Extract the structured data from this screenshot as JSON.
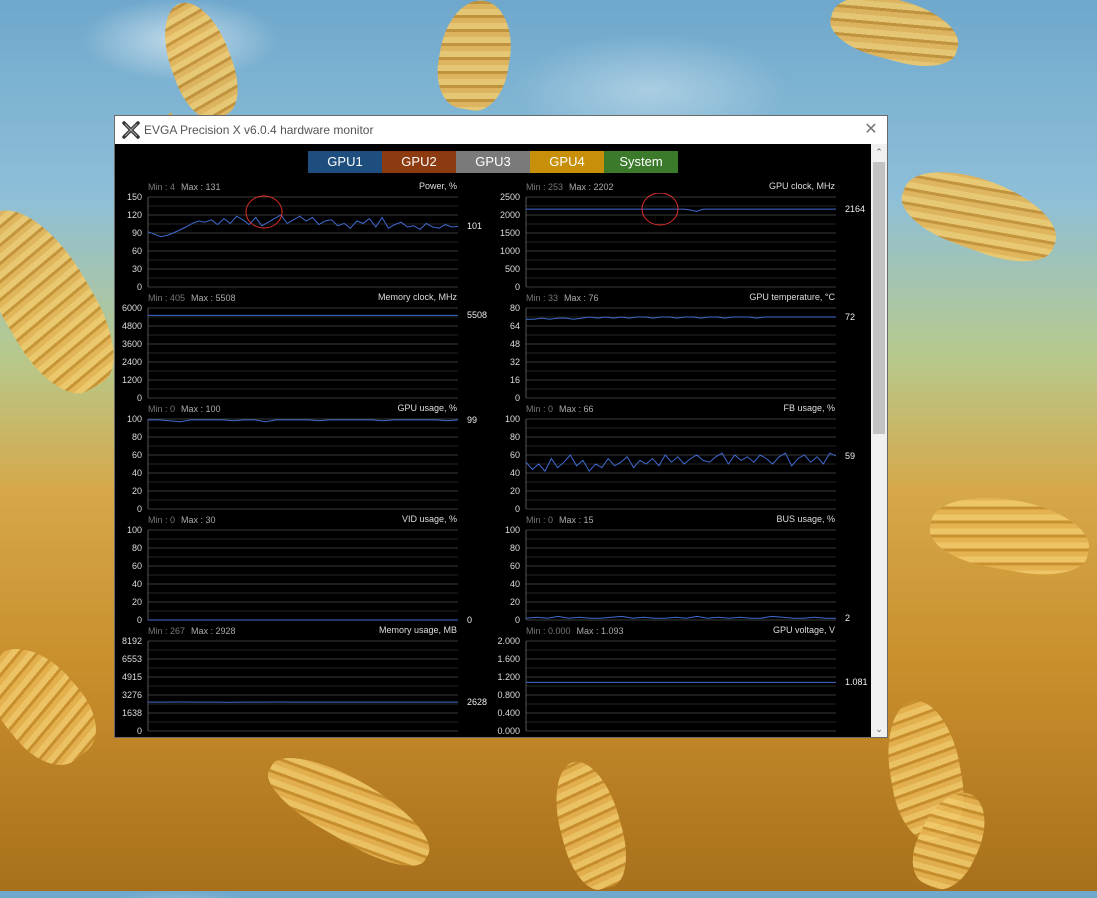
{
  "window": {
    "title": "EVGA Precision X v6.0.4 hardware monitor",
    "close_glyph": "✕"
  },
  "tabs": [
    {
      "label": "GPU1",
      "color": "#1e4e7e"
    },
    {
      "label": "GPU2",
      "color": "#8c3a10"
    },
    {
      "label": "GPU3",
      "color": "#7a7a7a"
    },
    {
      "label": "GPU4",
      "color": "#c8900a"
    },
    {
      "label": "System",
      "color": "#3a7a2a"
    }
  ],
  "scrollbar": {
    "up_glyph": "⌃",
    "down_glyph": "⌄"
  },
  "chart_data": [
    {
      "type": "line",
      "title": "Power, %",
      "min_text": "Min : 4",
      "max_text": "Max : 131",
      "ylabels": [
        "150",
        "120",
        "90",
        "60",
        "30",
        "0"
      ],
      "ylim": [
        0,
        150
      ],
      "current": "101",
      "series": [
        {
          "values": [
            92,
            88,
            84,
            86,
            90,
            95,
            100,
            106,
            110,
            108,
            112,
            104,
            114,
            106,
            118,
            112,
            104,
            116,
            102,
            108,
            114,
            120,
            106,
            112,
            118,
            110,
            116,
            104,
            110,
            112,
            102,
            106,
            98,
            110,
            106,
            114,
            100,
            116,
            98,
            104,
            108,
            100,
            102,
            96,
            106,
            100,
            98,
            104,
            100,
            101
          ]
        }
      ],
      "highlight_circle": true
    },
    {
      "type": "line",
      "title": "GPU clock, MHz",
      "min_text": "Min : 253",
      "max_text": "Max : 2202",
      "ylabels": [
        "2500",
        "2000",
        "1500",
        "1000",
        "500",
        "0"
      ],
      "ylim": [
        0,
        2500
      ],
      "current": "2164",
      "series": [
        {
          "values": [
            2164,
            2164,
            2164,
            2164,
            2164,
            2164,
            2164,
            2164,
            2164,
            2164,
            2164,
            2164,
            2164,
            2164,
            2164,
            2164,
            2164,
            2164,
            2164,
            2164,
            2164,
            2164,
            2164,
            2164,
            2164,
            2164,
            2140,
            2100,
            2164,
            2164,
            2164,
            2164,
            2164,
            2164,
            2164,
            2164,
            2164,
            2164,
            2164,
            2164,
            2164,
            2164,
            2164,
            2164,
            2164,
            2164,
            2164,
            2164,
            2164,
            2164
          ]
        }
      ],
      "highlight_circle": true
    },
    {
      "type": "line",
      "title": "Memory clock, MHz",
      "min_text": "Min : 405",
      "max_text": "Max : 5508",
      "ylabels": [
        "6000",
        "4800",
        "3600",
        "2400",
        "1200",
        "0"
      ],
      "ylim": [
        0,
        6000
      ],
      "current": "5508",
      "series": [
        {
          "values": [
            5508,
            5508,
            5508,
            5508,
            5508,
            5508,
            5508,
            5508,
            5508,
            5508,
            5508,
            5508,
            5508,
            5508,
            5508,
            5508,
            5508,
            5508,
            5508,
            5508
          ]
        }
      ]
    },
    {
      "type": "line",
      "title": "GPU temperature, °C",
      "min_text": "Min : 33",
      "max_text": "Max : 76",
      "ylabels": [
        "80",
        "64",
        "48",
        "32",
        "16",
        "0"
      ],
      "ylim": [
        0,
        80
      ],
      "current": "72",
      "series": [
        {
          "values": [
            70,
            70,
            71,
            70,
            71,
            71,
            70,
            71,
            72,
            71,
            72,
            71,
            72,
            71,
            72,
            72,
            71,
            72,
            72,
            71,
            72,
            72,
            71,
            72,
            72,
            71,
            72,
            72,
            72,
            71,
            72,
            72,
            72,
            72,
            72,
            72,
            72,
            72,
            72,
            72
          ]
        }
      ]
    },
    {
      "type": "line",
      "title": "GPU usage, %",
      "min_text": "Min : 0",
      "max_text": "Max : 100",
      "ylabels": [
        "100",
        "80",
        "60",
        "40",
        "20",
        "0"
      ],
      "ylim": [
        0,
        100
      ],
      "current": "99",
      "series": [
        {
          "values": [
            99,
            99,
            98,
            97,
            99,
            99,
            99,
            99,
            98,
            99,
            99,
            97,
            99,
            99,
            99,
            99,
            98,
            99,
            99,
            99,
            99,
            99,
            98,
            99,
            99,
            99,
            99,
            99,
            98,
            99
          ]
        }
      ]
    },
    {
      "type": "line",
      "title": "FB usage, %",
      "min_text": "Min : 0",
      "max_text": "Max : 66",
      "ylabels": [
        "100",
        "80",
        "60",
        "40",
        "20",
        "0"
      ],
      "ylim": [
        0,
        100
      ],
      "current": "59",
      "series": [
        {
          "values": [
            52,
            44,
            50,
            42,
            56,
            46,
            52,
            60,
            48,
            54,
            42,
            50,
            46,
            56,
            48,
            52,
            58,
            46,
            54,
            50,
            56,
            48,
            60,
            52,
            58,
            50,
            56,
            60,
            54,
            52,
            58,
            62,
            50,
            60,
            54,
            58,
            52,
            60,
            56,
            50,
            58,
            62,
            48,
            56,
            60,
            52,
            58,
            50,
            62,
            59
          ]
        }
      ]
    },
    {
      "type": "line",
      "title": "VID usage, %",
      "min_text": "Min : 0",
      "max_text": "Max : 30",
      "ylabels": [
        "100",
        "80",
        "60",
        "40",
        "20",
        "0"
      ],
      "ylim": [
        0,
        100
      ],
      "current": "0",
      "series": [
        {
          "values": [
            0,
            0,
            0,
            0,
            0,
            0,
            0,
            0,
            0,
            0
          ]
        }
      ]
    },
    {
      "type": "line",
      "title": "BUS usage, %",
      "min_text": "Min : 0",
      "max_text": "Max : 15",
      "ylabels": [
        "100",
        "80",
        "60",
        "40",
        "20",
        "0"
      ],
      "ylim": [
        0,
        100
      ],
      "current": "2",
      "series": [
        {
          "values": [
            2,
            3,
            2,
            4,
            2,
            3,
            2,
            2,
            3,
            4,
            2,
            3,
            2,
            2,
            3,
            2,
            4,
            2,
            3,
            2,
            3,
            2,
            2,
            4,
            3,
            2,
            2,
            3,
            2,
            2
          ]
        }
      ]
    },
    {
      "type": "line",
      "title": "Memory usage, MB",
      "min_text": "Min : 267",
      "max_text": "Max : 2928",
      "ylabels": [
        "8192",
        "6553",
        "4915",
        "3276",
        "1638",
        "0"
      ],
      "ylim": [
        0,
        8192
      ],
      "current": "2628",
      "series": [
        {
          "values": [
            2628,
            2628,
            2640,
            2628,
            2628,
            2620,
            2628,
            2628,
            2636,
            2628,
            2628,
            2628,
            2628,
            2628,
            2628,
            2628,
            2628,
            2628,
            2628,
            2628
          ]
        }
      ]
    },
    {
      "type": "line",
      "title": "GPU voltage, V",
      "min_text": "Min : 0.000",
      "max_text": "Max : 1.093",
      "ylabels": [
        "2.000",
        "1.600",
        "1.200",
        "0.800",
        "0.400",
        "0.000"
      ],
      "ylim": [
        0,
        2
      ],
      "current": "1.081",
      "series": [
        {
          "values": [
            1.081,
            1.081,
            1.081,
            1.081,
            1.081,
            1.081,
            1.081,
            1.081,
            1.081,
            1.081
          ]
        }
      ]
    }
  ]
}
